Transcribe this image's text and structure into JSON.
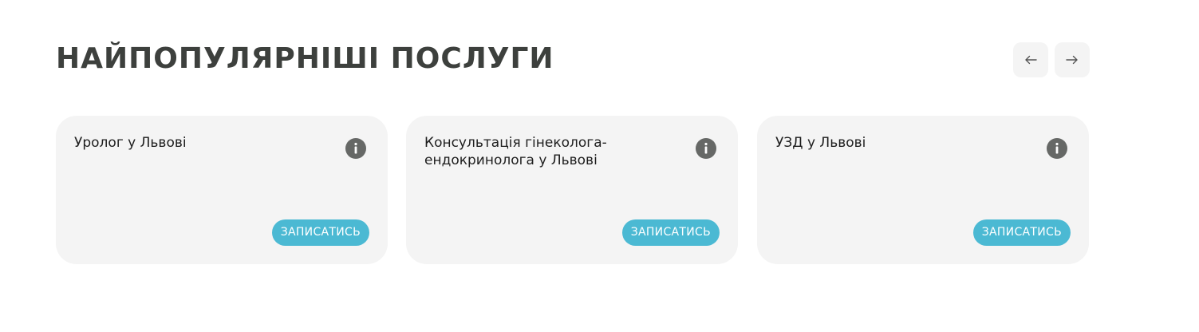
{
  "section": {
    "title": "НАЙПОПУЛЯРНІШІ ПОСЛУГИ",
    "prev_icon": "arrow-left-icon",
    "next_icon": "arrow-right-icon"
  },
  "services": [
    {
      "title": "Уролог у Львові",
      "button_label": "ЗАПИСАТИСЬ",
      "info_icon": "info-icon"
    },
    {
      "title": "Консультація гінеколога-ендокринолога у Львові",
      "button_label": "ЗАПИСАТИСЬ",
      "info_icon": "info-icon"
    },
    {
      "title": "УЗД у Львові",
      "button_label": "ЗАПИСАТИСЬ",
      "info_icon": "info-icon"
    }
  ],
  "colors": {
    "title": "#3d403d",
    "card_background": "#f4f4f4",
    "accent_button": "#4bb9d3",
    "info_icon": "#666866",
    "nav_button": "#f4f4f4"
  }
}
